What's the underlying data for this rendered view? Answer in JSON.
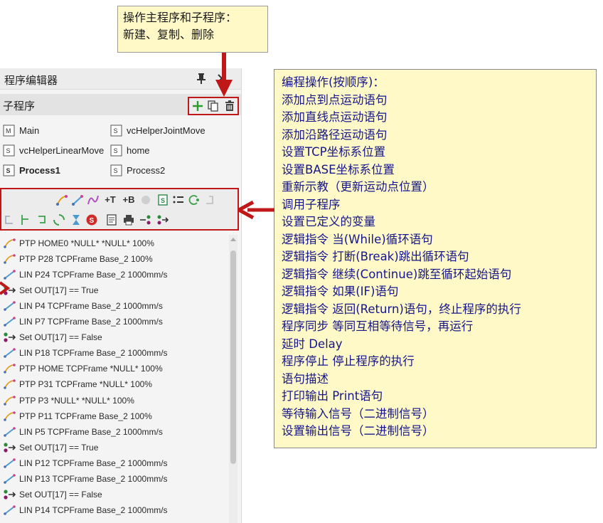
{
  "panel": {
    "title": "程序编辑器",
    "subroutine_header": "子程序",
    "routines": [
      {
        "label": "Main",
        "icon": "main-routine-icon",
        "bold": false
      },
      {
        "label": "vcHelperJointMove",
        "icon": "subroutine-icon",
        "bold": false
      },
      {
        "label": "vcHelperLinearMove",
        "icon": "subroutine-icon",
        "bold": false
      },
      {
        "label": "home",
        "icon": "subroutine-icon",
        "bold": false
      },
      {
        "label": "Process1",
        "icon": "subroutine-icon",
        "bold": true
      },
      {
        "label": "Process2",
        "icon": "subroutine-icon",
        "bold": false
      }
    ],
    "toolbar": {
      "row1": [
        "ptp-motion-icon",
        "linear-motion-icon",
        "path-motion-icon",
        "set-tcp-icon",
        "set-base-icon",
        "reteach-icon",
        "call-subroutine-icon",
        "define-variable-icon",
        "while-loop-icon",
        "break-icon"
      ],
      "row1_text": {
        "tcp": "+T",
        "base": "+B"
      },
      "row2": [
        "continue-icon",
        "if-icon",
        "return-icon",
        "sync-icon",
        "delay-icon",
        "stop-icon",
        "comment-icon",
        "print-icon",
        "wait-input-icon",
        "set-output-icon"
      ]
    },
    "statements": [
      {
        "type": "ptp",
        "text": "PTP HOME0 *NULL* *NULL* 100%"
      },
      {
        "type": "ptp",
        "text": "PTP P28 TCPFrame Base_2 100%"
      },
      {
        "type": "lin",
        "text": "LIN P24 TCPFrame Base_2 1000mm/s"
      },
      {
        "type": "set",
        "text": "Set OUT[17] == True"
      },
      {
        "type": "lin",
        "text": "LIN P4 TCPFrame Base_2 1000mm/s"
      },
      {
        "type": "lin",
        "text": "LIN P7 TCPFrame Base_2 1000mm/s"
      },
      {
        "type": "set",
        "text": "Set OUT[17] == False"
      },
      {
        "type": "lin",
        "text": "LIN P18 TCPFrame Base_2 1000mm/s"
      },
      {
        "type": "ptp",
        "text": "PTP HOME TCPFrame *NULL* 100%"
      },
      {
        "type": "ptp",
        "text": "PTP P31 TCPFrame *NULL* 100%"
      },
      {
        "type": "ptp",
        "text": "PTP P3 *NULL* *NULL* 100%"
      },
      {
        "type": "ptp",
        "text": "PTP P11 TCPFrame Base_2 100%"
      },
      {
        "type": "lin",
        "text": "LIN P5 TCPFrame Base_2 1000mm/s"
      },
      {
        "type": "set",
        "text": "Set OUT[17] == True"
      },
      {
        "type": "lin",
        "text": "LIN P12 TCPFrame Base_2 1000mm/s"
      },
      {
        "type": "lin",
        "text": "LIN P13 TCPFrame Base_2 1000mm/s"
      },
      {
        "type": "set",
        "text": "Set OUT[17] == False"
      },
      {
        "type": "lin",
        "text": "LIN P14 TCPFrame Base_2 1000mm/s"
      }
    ]
  },
  "callout_top": {
    "line1": "操作主程序和子程序：",
    "line2": "新建、复制、删除"
  },
  "callout_right": {
    "lines": [
      "编程操作(按顺序)：",
      "添加点到点运动语句",
      "添加直线点运动语句",
      "添加沿路径运动语句",
      "设置TCP坐标系位置",
      "设置BASE坐标系位置",
      "重新示教（更新运动点位置）",
      "调用子程序",
      "设置已定义的变量",
      "逻辑指令 当(While)循环语句",
      "逻辑指令 打断(Break)跳出循环语句",
      "逻辑指令 继续(Continue)跳至循环起始语句",
      "逻辑指令 如果(IF)语句",
      "逻辑指令 返回(Return)语句，终止程序的执行",
      "程序同步 等同互相等待信号，再运行",
      "延时  Delay",
      "程序停止 停止程序的执行",
      "语句描述",
      "打印输出 Print语句",
      "等待输入信号（二进制信号）",
      "设置输出信号（二进制信号）"
    ]
  },
  "colors": {
    "highlight": "#c01818",
    "callout_bg": "#fff9c8",
    "callout_text": "#16168a"
  }
}
